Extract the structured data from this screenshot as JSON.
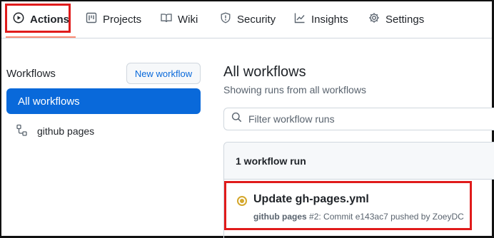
{
  "nav": {
    "tabs": [
      {
        "label": "Actions",
        "icon": "play-circle-icon",
        "active": true
      },
      {
        "label": "Projects",
        "icon": "project-board-icon"
      },
      {
        "label": "Wiki",
        "icon": "book-icon"
      },
      {
        "label": "Security",
        "icon": "shield-icon"
      },
      {
        "label": "Insights",
        "icon": "graph-icon"
      },
      {
        "label": "Settings",
        "icon": "gear-icon"
      }
    ]
  },
  "sidebar": {
    "header": "Workflows",
    "new_workflow_label": "New workflow",
    "items": [
      {
        "label": "All workflows",
        "active": true
      },
      {
        "label": "github pages",
        "icon": "workflow-icon"
      }
    ]
  },
  "main": {
    "title": "All workflows",
    "subtitle": "Showing runs from all workflows",
    "filter_placeholder": "Filter workflow runs",
    "runs_count_label": "1 workflow run",
    "runs": [
      {
        "title": "Update gh-pages.yml",
        "workflow": "github pages",
        "meta": "#2: Commit e143ac7 pushed by ZoeyDC",
        "status": "in-progress"
      }
    ]
  },
  "colors": {
    "accent": "#0969da",
    "highlight": "#e01b1b",
    "status_pending": "#d4a72c",
    "tab_underline": "#fd8c73"
  }
}
